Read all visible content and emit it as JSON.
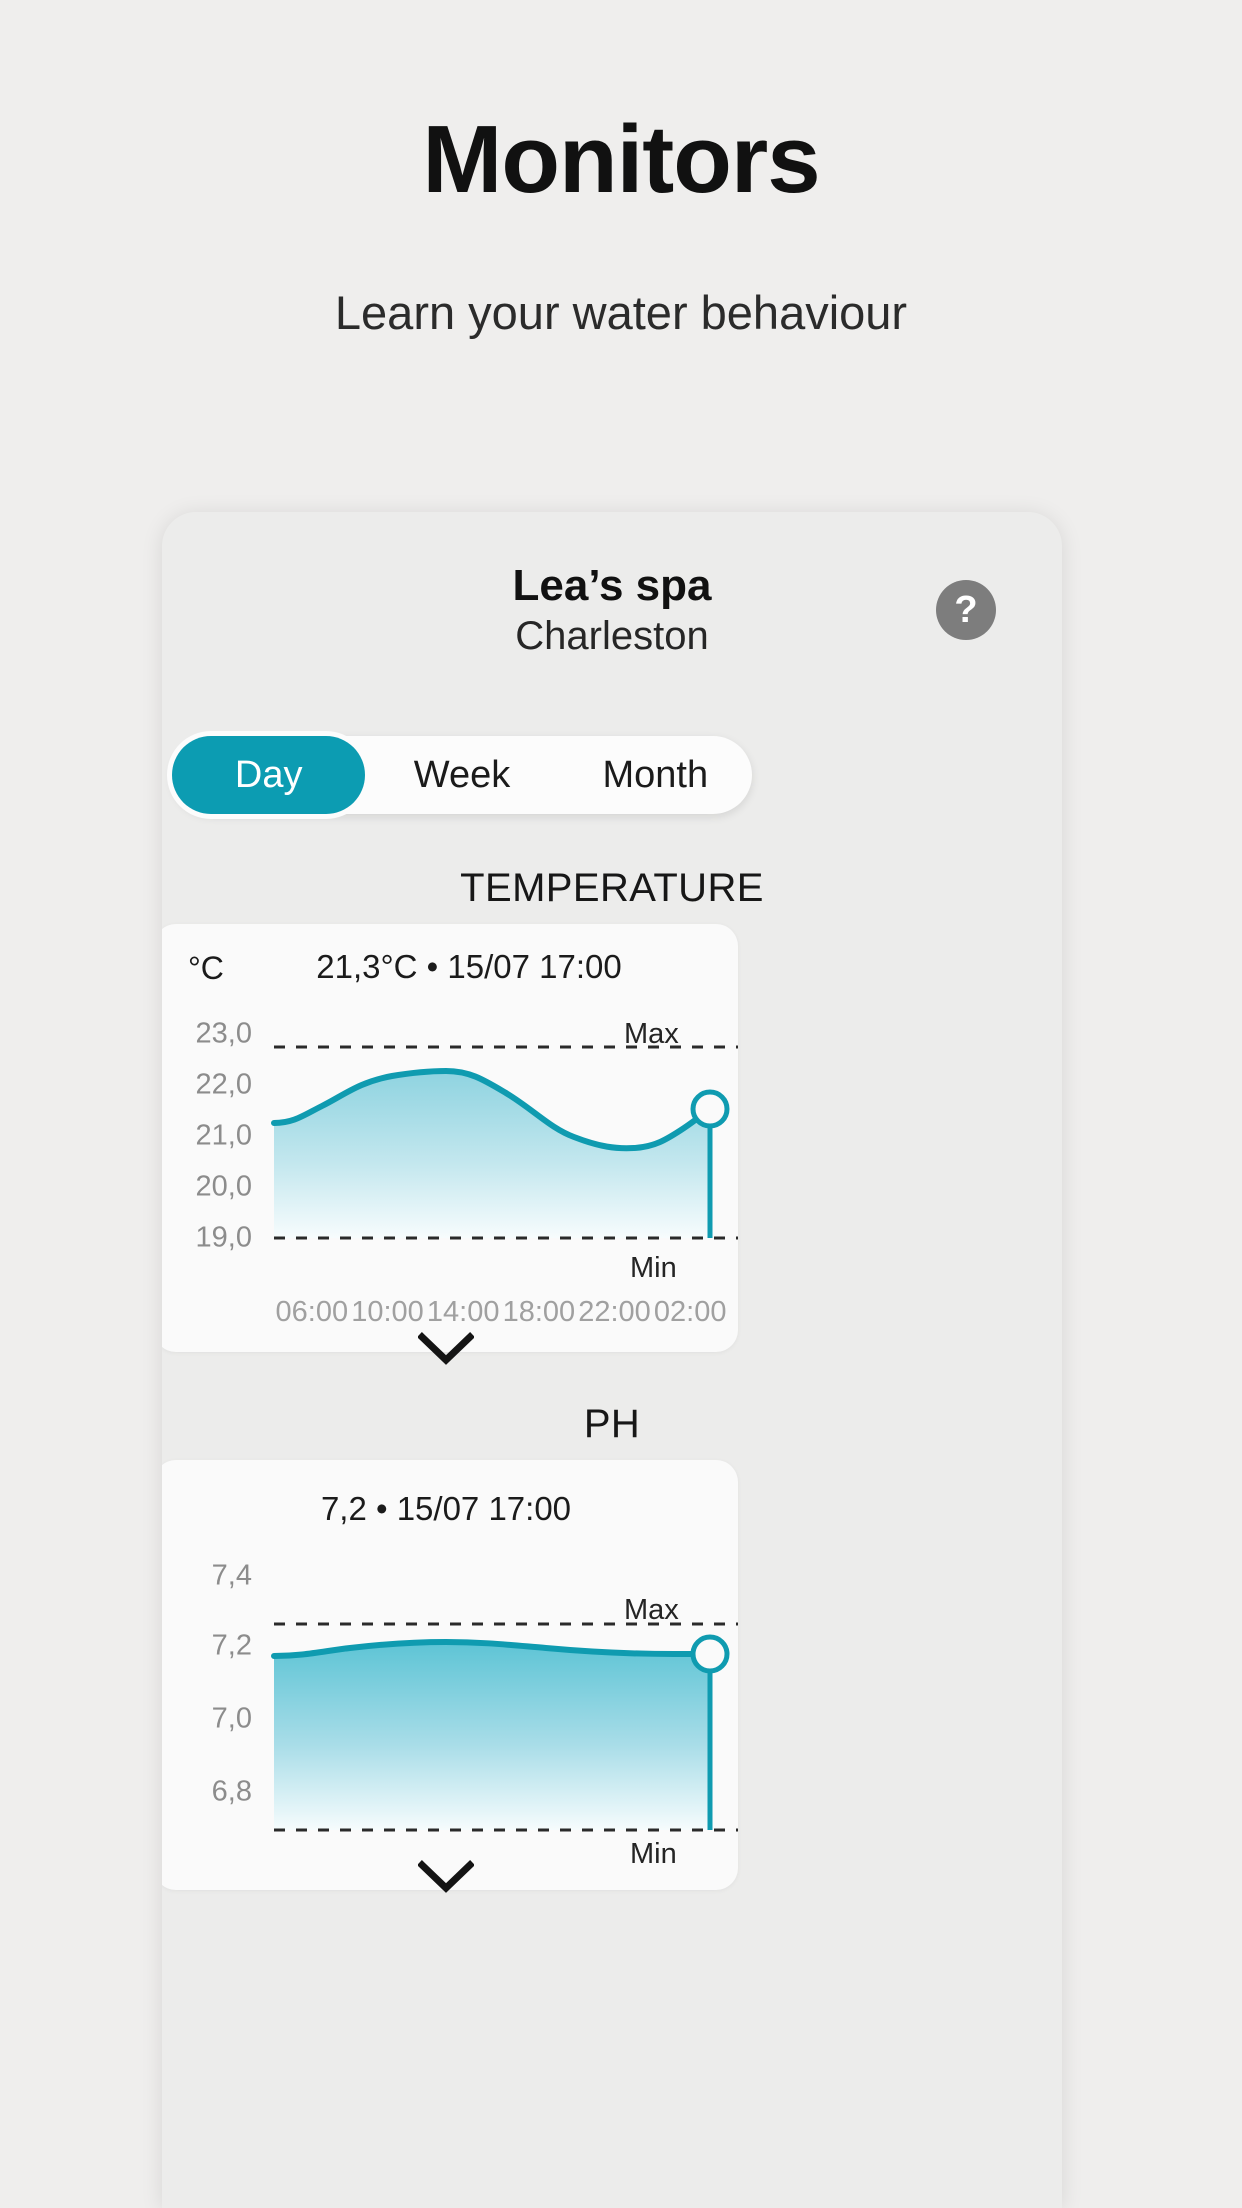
{
  "hero": {
    "title": "Monitors",
    "subtitle": "Learn your water behaviour"
  },
  "panel": {
    "spa_name": "Lea’s spa",
    "location": "Charleston",
    "help_glyph": "?",
    "help_name": "help-button"
  },
  "segmented": {
    "options": [
      "Day",
      "Week",
      "Month"
    ],
    "selected": "Day",
    "active_color": "#0c9cb2"
  },
  "sections": [
    {
      "label": "TEMPERATURE",
      "unit": "°C",
      "reading": "21,3°C • 15/07 17:00",
      "max_label": "Max",
      "min_label": "Min",
      "expand_icon": "chevron-down-icon"
    },
    {
      "label": "PH",
      "unit": "",
      "reading": "7,2 • 15/07 17:00",
      "max_label": "Max",
      "min_label": "Min",
      "expand_icon": "chevron-down-icon"
    }
  ],
  "chart_data": [
    {
      "type": "area",
      "title": "TEMPERATURE",
      "subtitle": "21,3°C • 15/07 17:00",
      "ylabel": "°C",
      "xlabel": "",
      "yticks": [
        "23,0",
        "22,0",
        "21,0",
        "20,0",
        "19,0"
      ],
      "ytick_values": [
        23.0,
        22.0,
        21.0,
        20.0,
        19.0
      ],
      "ylim": [
        19.0,
        23.0
      ],
      "xticks": [
        "06:00",
        "10:00",
        "14:00",
        "18:00",
        "22:00",
        "02:00"
      ],
      "grid": false,
      "legend": "none",
      "max_threshold": 22.55,
      "min_threshold": 19.85,
      "max_threshold_label": "Max",
      "min_threshold_label": "Min",
      "last_point_marker": true,
      "line_color": "#0f9bb0",
      "fill_top_color": "#9bd8e3",
      "fill_bottom_color": "#f4fbfc",
      "x": [
        0,
        1,
        2,
        3,
        4,
        5,
        6,
        7,
        8,
        9,
        10,
        11,
        12
      ],
      "values": [
        21.25,
        21.35,
        21.72,
        22.0,
        22.05,
        21.85,
        21.45,
        21.05,
        20.8,
        20.72,
        20.78,
        21.05,
        21.6
      ]
    },
    {
      "type": "area",
      "title": "PH",
      "subtitle": "7,2 • 15/07 17:00",
      "ylabel": "",
      "xlabel": "",
      "yticks": [
        "7,4",
        "7,2",
        "7,0",
        "6,8"
      ],
      "ytick_values": [
        7.4,
        7.2,
        7.0,
        6.8
      ],
      "ylim": [
        6.8,
        7.4
      ],
      "xticks": [],
      "grid": false,
      "legend": "none",
      "max_threshold": 7.27,
      "min_threshold": 6.74,
      "max_threshold_label": "Max",
      "min_threshold_label": "Min",
      "last_point_marker": true,
      "line_color": "#0f9bb0",
      "fill_top_color": "#62c6d6",
      "fill_bottom_color": "#f4fbfc",
      "x": [
        0,
        1,
        2,
        3,
        4,
        5,
        6,
        7,
        8,
        9,
        10,
        11,
        12
      ],
      "values": [
        7.19,
        7.2,
        7.215,
        7.225,
        7.228,
        7.225,
        7.218,
        7.212,
        7.208,
        7.205,
        7.204,
        7.205,
        7.205
      ]
    }
  ]
}
